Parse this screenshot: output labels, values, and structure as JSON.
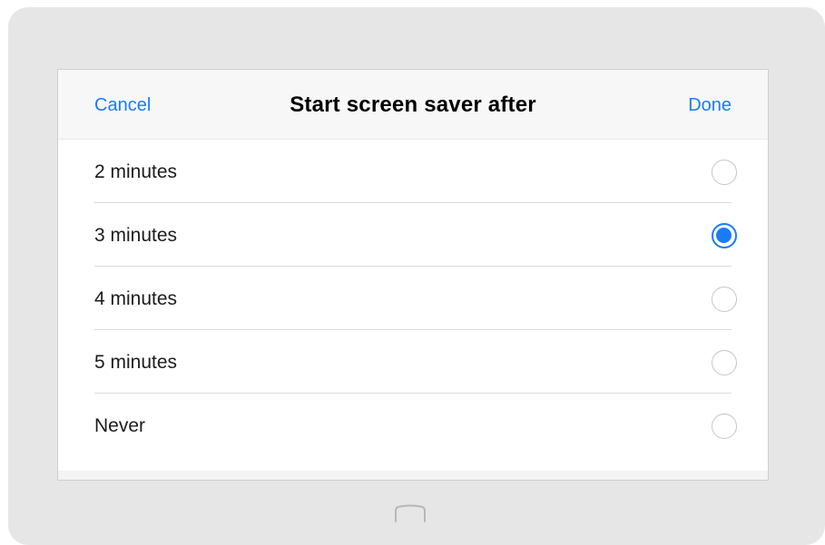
{
  "dialog": {
    "title": "Start screen saver after",
    "cancel_label": "Cancel",
    "done_label": "Done"
  },
  "options": [
    {
      "label": "2 minutes",
      "selected": false
    },
    {
      "label": "3 minutes",
      "selected": true
    },
    {
      "label": "4 minutes",
      "selected": false
    },
    {
      "label": "5 minutes",
      "selected": false
    },
    {
      "label": "Never",
      "selected": false
    }
  ],
  "colors": {
    "accent": "#1a7cf5",
    "frame": "#e6e6e6",
    "header_bg": "#f7f7f7"
  },
  "icons": {
    "home": "home-button-icon"
  }
}
